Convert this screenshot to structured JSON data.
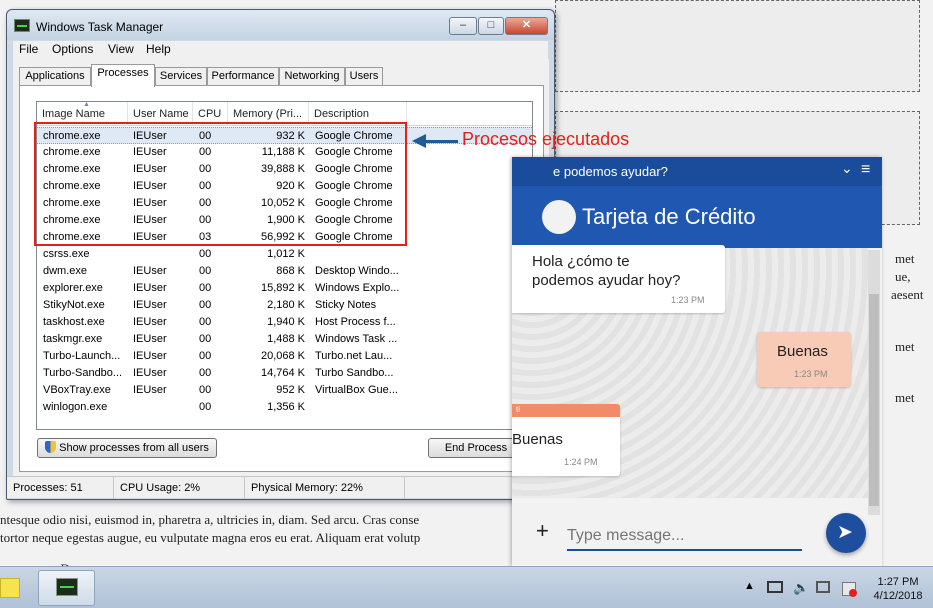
{
  "background_page": {
    "right_fragments": [
      "met",
      "ue,",
      "aesent",
      "met",
      "met"
    ],
    "line1": "ntesque odio nisi, euismod in, pharetra a, ultricies in, diam. Sed arcu. Cras conse",
    "line2": "tortor neque egestas augue, eu vulputate magna eros eu erat. Aliquam erat volutp",
    "line3": ". D"
  },
  "task_manager": {
    "title": "Windows Task Manager",
    "controls": {
      "minimize": "–",
      "maximize": "□",
      "close": "✕"
    },
    "menu": [
      "File",
      "Options",
      "View",
      "Help"
    ],
    "tabs": [
      "Applications",
      "Processes",
      "Services",
      "Performance",
      "Networking",
      "Users"
    ],
    "active_tab": "Processes",
    "columns": [
      "Image Name",
      "User Name",
      "CPU",
      "Memory (Pri...",
      "Description"
    ],
    "rows": [
      [
        "chrome.exe",
        "IEUser",
        "00",
        "932 K",
        "Google Chrome"
      ],
      [
        "chrome.exe",
        "IEUser",
        "00",
        "11,188 K",
        "Google Chrome"
      ],
      [
        "chrome.exe",
        "IEUser",
        "00",
        "39,888 K",
        "Google Chrome"
      ],
      [
        "chrome.exe",
        "IEUser",
        "00",
        "920 K",
        "Google Chrome"
      ],
      [
        "chrome.exe",
        "IEUser",
        "00",
        "10,052 K",
        "Google Chrome"
      ],
      [
        "chrome.exe",
        "IEUser",
        "00",
        "1,900 K",
        "Google Chrome"
      ],
      [
        "chrome.exe",
        "IEUser",
        "03",
        "56,992 K",
        "Google Chrome"
      ],
      [
        "csrss.exe",
        "",
        "00",
        "1,012 K",
        ""
      ],
      [
        "dwm.exe",
        "IEUser",
        "00",
        "868 K",
        "Desktop Windo..."
      ],
      [
        "explorer.exe",
        "IEUser",
        "00",
        "15,892 K",
        "Windows Explo..."
      ],
      [
        "StikyNot.exe",
        "IEUser",
        "00",
        "2,180 K",
        "Sticky Notes"
      ],
      [
        "taskhost.exe",
        "IEUser",
        "00",
        "1,940 K",
        "Host Process f..."
      ],
      [
        "taskmgr.exe",
        "IEUser",
        "00",
        "1,488 K",
        "Windows Task ..."
      ],
      [
        "Turbo-Launch...",
        "IEUser",
        "00",
        "20,068 K",
        "Turbo.net Lau..."
      ],
      [
        "Turbo-Sandbo...",
        "IEUser",
        "00",
        "14,764 K",
        "Turbo Sandbo..."
      ],
      [
        "VBoxTray.exe",
        "IEUser",
        "00",
        "952 K",
        "VirtualBox Gue..."
      ],
      [
        "winlogon.exe",
        "",
        "00",
        "1,356 K",
        ""
      ]
    ],
    "show_all_button": "Show processes from all users",
    "end_process_button": "End Process",
    "status": {
      "processes": "Processes: 51",
      "cpu": "CPU Usage: 2%",
      "memory": "Physical Memory: 22%"
    }
  },
  "annotation": {
    "label": "Procesos ejecutados",
    "color": "#e0221b",
    "arrow_color": "#1c5d99"
  },
  "chat": {
    "top_title": "e podemos ayudar?",
    "chevron": "⌄",
    "menu": "≡",
    "header_name": "Tarjeta de Crédito",
    "messages": [
      {
        "from": "agent",
        "lines": [
          "Hola ¿cómo te",
          "podemos ayudar hoy?"
        ],
        "time": "1:23 PM"
      },
      {
        "from": "user",
        "lines": [
          "Buenas"
        ],
        "time": "1:23 PM"
      },
      {
        "from": "agent",
        "tag": "ti",
        "lines": [
          "Buenas"
        ],
        "time": "1:24 PM"
      }
    ],
    "plus": "+",
    "input_placeholder": "Type message...",
    "send_icon": "➤",
    "accent": "#2057b0"
  },
  "taskbar": {
    "time": "1:27 PM",
    "date": "4/12/2018"
  }
}
